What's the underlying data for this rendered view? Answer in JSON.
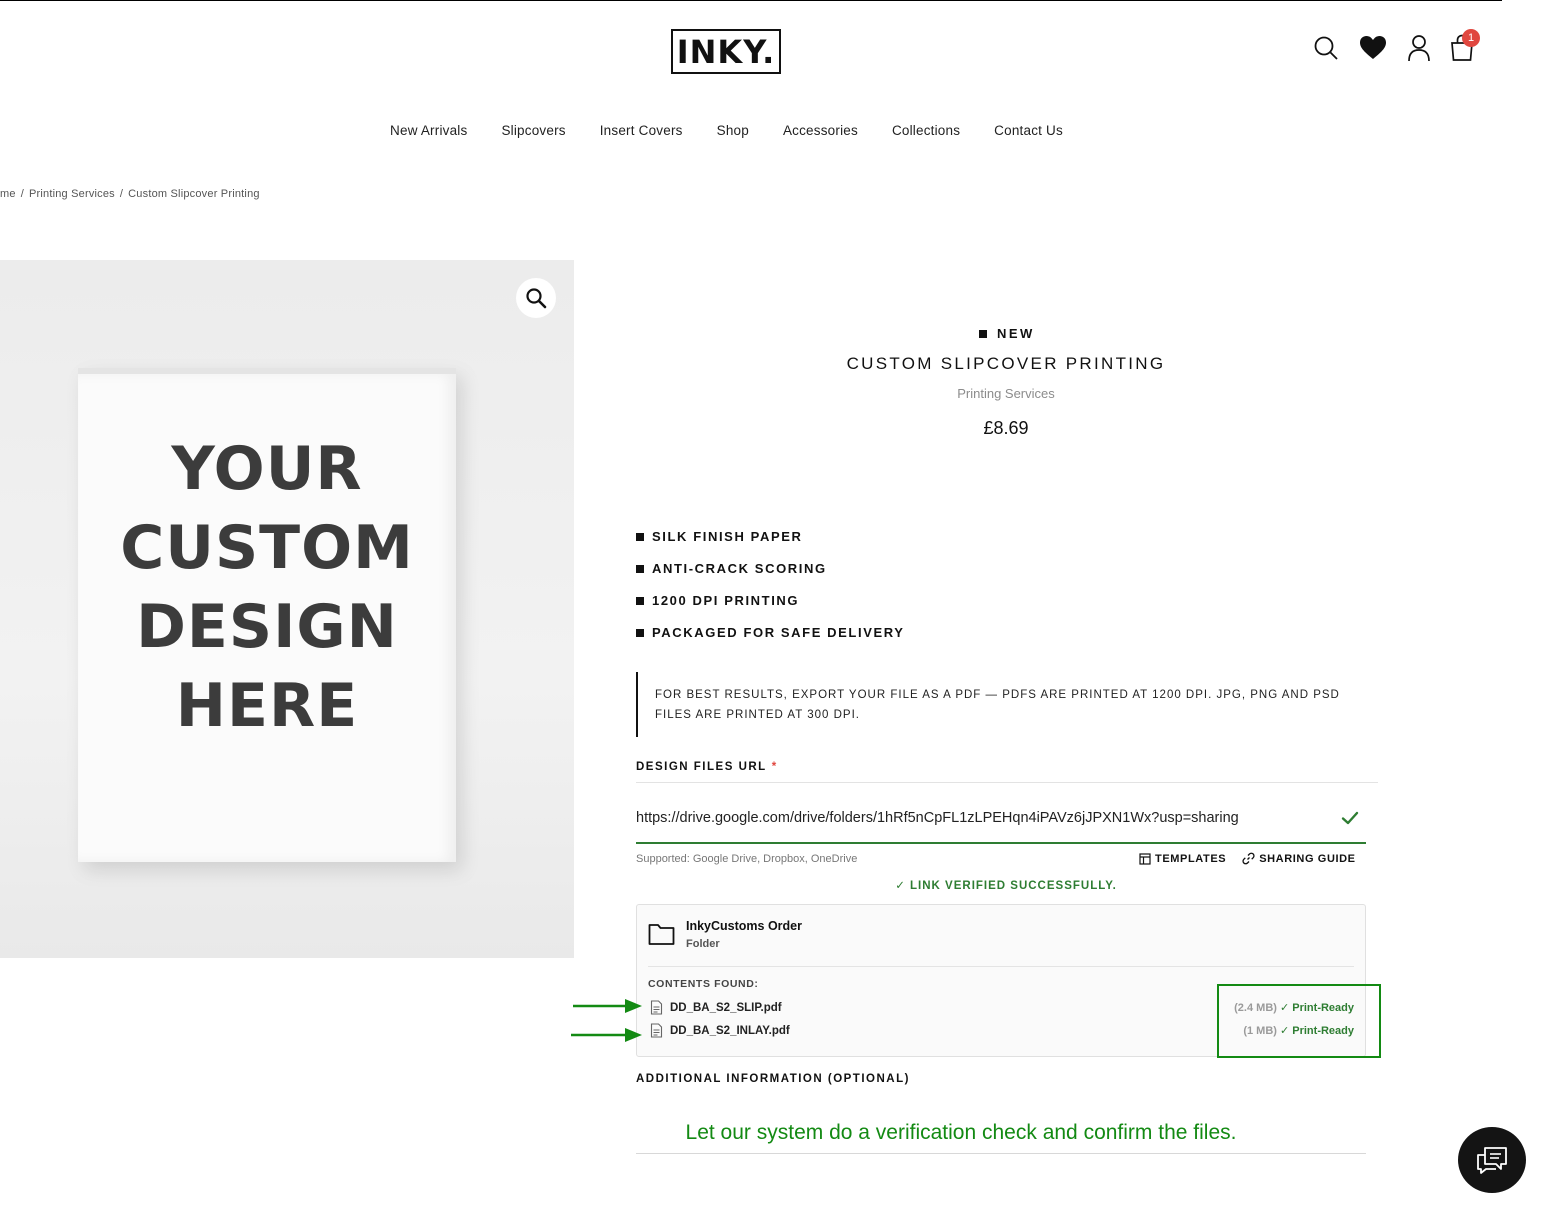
{
  "header": {
    "logo": "INKY.",
    "cart_count": "1"
  },
  "nav": [
    "New Arrivals",
    "Slipcovers",
    "Insert Covers",
    "Shop",
    "Accessories",
    "Collections",
    "Contact Us"
  ],
  "breadcrumb": [
    "me",
    "Printing Services",
    "Custom Slipcover Printing"
  ],
  "hero": {
    "lines": [
      "YOUR",
      "CUSTOM",
      "DESIGN",
      "HERE"
    ]
  },
  "product": {
    "badge": "NEW",
    "title": "CUSTOM SLIPCOVER PRINTING",
    "category": "Printing Services",
    "price": "£8.69",
    "features": [
      "SILK FINISH PAPER",
      "ANTI-CRACK SCORING",
      "1200 DPI PRINTING",
      "PACKAGED FOR SAFE DELIVERY"
    ],
    "note": "FOR BEST RESULTS, EXPORT YOUR FILE AS A PDF — PDFS ARE PRINTED AT 1200 DPI. JPG, PNG AND PSD FILES ARE PRINTED AT 300 DPI."
  },
  "design_url": {
    "label": "DESIGN FILES URL",
    "required_mark": "*",
    "value": "https://drive.google.com/drive/folders/1hRf5nCpFL1zLPEHqn4iPAVz6jJPXN1Wx?usp=sharing",
    "supported": "Supported: Google Drive, Dropbox, OneDrive",
    "templates_label": "TEMPLATES",
    "sharing_label": "SHARING GUIDE",
    "verified": "✓ LINK VERIFIED SUCCESSFULLY."
  },
  "folder": {
    "name": "InkyCustoms Order",
    "type": "Folder",
    "contents_label": "CONTENTS FOUND:",
    "files": [
      {
        "name": "DD_BA_S2_SLIP.pdf",
        "size": "(2.4 MB)",
        "status": "✓ Print-Ready"
      },
      {
        "name": "DD_BA_S2_INLAY.pdf",
        "size": "(1 MB)",
        "status": "✓ Print-Ready"
      }
    ]
  },
  "additional_label": "ADDITIONAL INFORMATION (OPTIONAL)",
  "annotation": "Let our system do a verification check and confirm the files.",
  "colors": {
    "accent_green": "#2e7d32",
    "annotation_green": "#138a13",
    "badge_red": "#e0473f"
  }
}
